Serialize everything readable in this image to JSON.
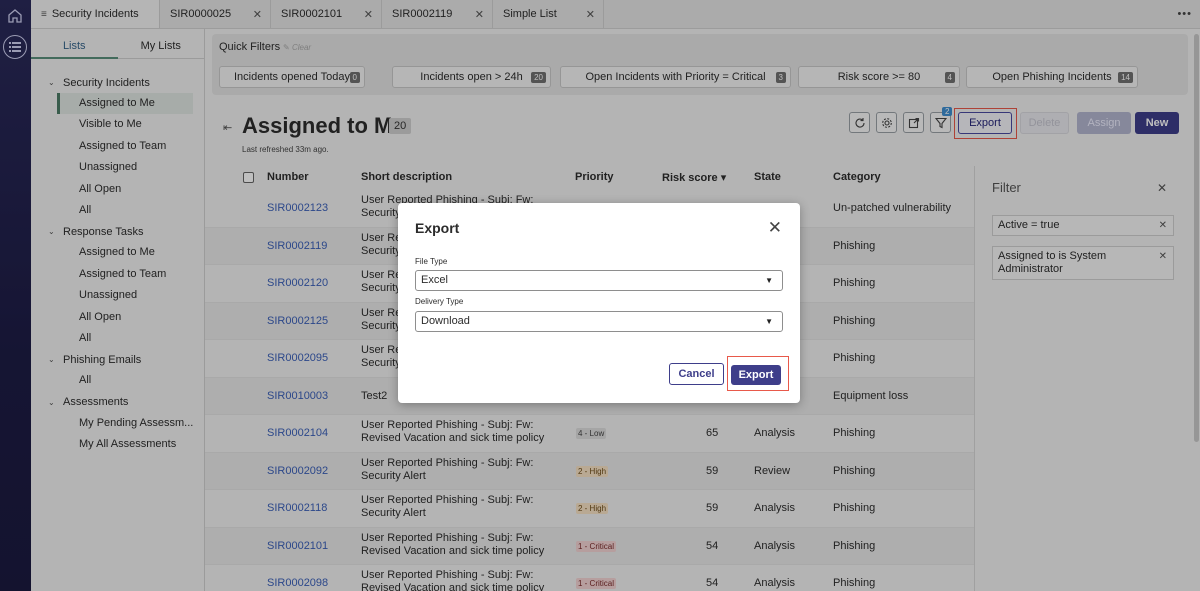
{
  "tabs": [
    {
      "label": "Security Incidents"
    },
    {
      "label": "SIR0000025"
    },
    {
      "label": "SIR0002101"
    },
    {
      "label": "SIR0002119"
    },
    {
      "label": "Simple List"
    }
  ],
  "left_panel": {
    "tabs": [
      "Lists",
      "My Lists"
    ],
    "groups": [
      {
        "label": "Security Incidents",
        "items": [
          "Assigned to Me",
          "Visible to Me",
          "Assigned to Team",
          "Unassigned",
          "All Open",
          "All"
        ]
      },
      {
        "label": "Response Tasks",
        "items": [
          "Assigned to Me",
          "Assigned to Team",
          "Unassigned",
          "All Open",
          "All"
        ]
      },
      {
        "label": "Phishing Emails",
        "items": [
          "All"
        ]
      },
      {
        "label": "Assessments",
        "items": [
          "My Pending Assessm...",
          "My All Assessments"
        ]
      }
    ]
  },
  "quick_filters": {
    "title": "Quick Filters",
    "clear": "Clear",
    "buttons": [
      {
        "label": "Incidents opened Today",
        "count": "0"
      },
      {
        "label": "Incidents open > 24h",
        "count": "20"
      },
      {
        "label": "Open Incidents with Priority = Critical",
        "count": "3"
      },
      {
        "label": "Risk score >= 80",
        "count": "4"
      },
      {
        "label": "Open Phishing Incidents",
        "count": "14"
      }
    ]
  },
  "list": {
    "title": "Assigned to Me",
    "count": "20",
    "refreshed": "Last refreshed 33m ago.",
    "filter_badge": "2",
    "actions": {
      "export": "Export",
      "delete": "Delete",
      "assign": "Assign",
      "new": "New"
    },
    "columns": [
      "Number",
      "Short description",
      "Priority",
      "Risk score ▾",
      "State",
      "Category"
    ],
    "rows": [
      {
        "number": "SIR0002123",
        "desc": [
          "User Reported Phishing - Subj: Fw:",
          "Security"
        ],
        "priority": "",
        "prio_class": "",
        "risk": "",
        "state": "",
        "category": "Un-patched vulnerability"
      },
      {
        "number": "SIR0002119",
        "desc": [
          "User Re",
          "Security"
        ],
        "priority": "",
        "prio_class": "",
        "risk": "",
        "state": "",
        "category": "Phishing"
      },
      {
        "number": "SIR0002120",
        "desc": [
          "User Re",
          "Security"
        ],
        "priority": "",
        "prio_class": "",
        "risk": "",
        "state": "",
        "category": "Phishing"
      },
      {
        "number": "SIR0002125",
        "desc": [
          "User Re",
          "Security"
        ],
        "priority": "",
        "prio_class": "",
        "risk": "",
        "state": "",
        "category": "Phishing"
      },
      {
        "number": "SIR0002095",
        "desc": [
          "User Re",
          "Security"
        ],
        "priority": "",
        "prio_class": "",
        "risk": "",
        "state": "",
        "category": "Phishing"
      },
      {
        "number": "SIR0010003",
        "desc": [
          "Test2"
        ],
        "priority": "",
        "prio_class": "",
        "risk": "",
        "state": "",
        "category": "Equipment loss"
      },
      {
        "number": "SIR0002104",
        "desc": [
          "User Reported Phishing - Subj: Fw:",
          "Revised Vacation and sick time policy"
        ],
        "priority": "4 - Low",
        "prio_class": "prio-low",
        "risk": "65",
        "state": "Analysis",
        "category": "Phishing"
      },
      {
        "number": "SIR0002092",
        "desc": [
          "User Reported Phishing - Subj: Fw:",
          "Security Alert"
        ],
        "priority": "2 - High",
        "prio_class": "prio-high",
        "risk": "59",
        "state": "Review",
        "category": "Phishing"
      },
      {
        "number": "SIR0002118",
        "desc": [
          "User Reported Phishing - Subj: Fw:",
          "Security Alert"
        ],
        "priority": "2 - High",
        "prio_class": "prio-high",
        "risk": "59",
        "state": "Analysis",
        "category": "Phishing"
      },
      {
        "number": "SIR0002101",
        "desc": [
          "User Reported Phishing - Subj: Fw:",
          "Revised Vacation and sick time policy"
        ],
        "priority": "1 - Critical",
        "prio_class": "prio-crit",
        "risk": "54",
        "state": "Analysis",
        "category": "Phishing"
      },
      {
        "number": "SIR0002098",
        "desc": [
          "User Reported Phishing - Subj: Fw:",
          "Revised Vacation and sick time policy"
        ],
        "priority": "1 - Critical",
        "prio_class": "prio-crit",
        "risk": "54",
        "state": "Analysis",
        "category": "Phishing"
      }
    ]
  },
  "filter_panel": {
    "title": "Filter",
    "chips": [
      "Active = true",
      "Assigned to is System Administrator"
    ]
  },
  "modal": {
    "title": "Export",
    "file_type_label": "File Type",
    "file_type_value": "Excel",
    "delivery_type_label": "Delivery Type",
    "delivery_type_value": "Download",
    "cancel": "Cancel",
    "export": "Export"
  },
  "colors": {
    "accent": "#3e3e8a",
    "highlight": "#e8594a",
    "link": "#3a5fb8"
  }
}
